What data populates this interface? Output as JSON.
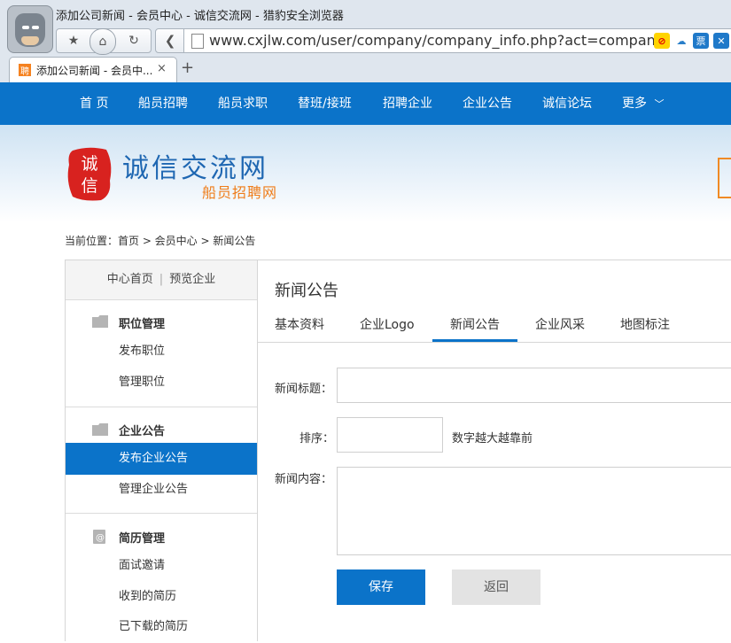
{
  "browser": {
    "window_title": "添加公司新闻 - 会员中心 - 诚信交流网 - 猎豹安全浏览器",
    "url": "www.cxjlw.com/user/company/company_info.php?act=company_new",
    "tab_title": "添加公司新闻 - 会员中...",
    "tab_favicon_text": "聘",
    "tab_close": "×",
    "new_tab": "+",
    "ext_ticket": "票",
    "colors": {
      "chrome_bg": "#dfe6ee",
      "accent": "#0b73c9"
    }
  },
  "site_nav": {
    "items": [
      {
        "label": "首 页"
      },
      {
        "label": "船员招聘"
      },
      {
        "label": "船员求职"
      },
      {
        "label": "替班/接班"
      },
      {
        "label": "招聘企业"
      },
      {
        "label": "企业公告"
      },
      {
        "label": "诚信论坛"
      },
      {
        "label": "更多"
      }
    ]
  },
  "logo": {
    "seal_chars": [
      "诚",
      "信"
    ],
    "title": "诚信交流网",
    "subtitle": "船员招聘网"
  },
  "breadcrumb": "当前位置：首页 > 会员中心 > 新闻公告",
  "sidebar": {
    "top_links": [
      "中心首页",
      "预览企业"
    ],
    "top_sep": "|",
    "groups": [
      {
        "title": "职位管理",
        "items": [
          "发布职位",
          "管理职位"
        ]
      },
      {
        "title": "企业公告",
        "items": [
          "发布企业公告",
          "管理企业公告"
        ]
      },
      {
        "title": "简历管理",
        "items": [
          "面试邀请",
          "收到的简历",
          "已下载的简历"
        ]
      }
    ]
  },
  "main": {
    "title": "新闻公告",
    "tabs": [
      {
        "label": "基本资料"
      },
      {
        "label": "企业Logo"
      },
      {
        "label": "新闻公告",
        "active": true
      },
      {
        "label": "企业风采"
      },
      {
        "label": "地图标注"
      }
    ],
    "form": {
      "title_label": "新闻标题：",
      "title_value": "",
      "order_label": "排序：",
      "order_value": "",
      "order_hint": "数字越大越靠前",
      "content_label": "新闻内容：",
      "content_value": ""
    },
    "buttons": {
      "save": "保存",
      "back": "返回"
    }
  }
}
